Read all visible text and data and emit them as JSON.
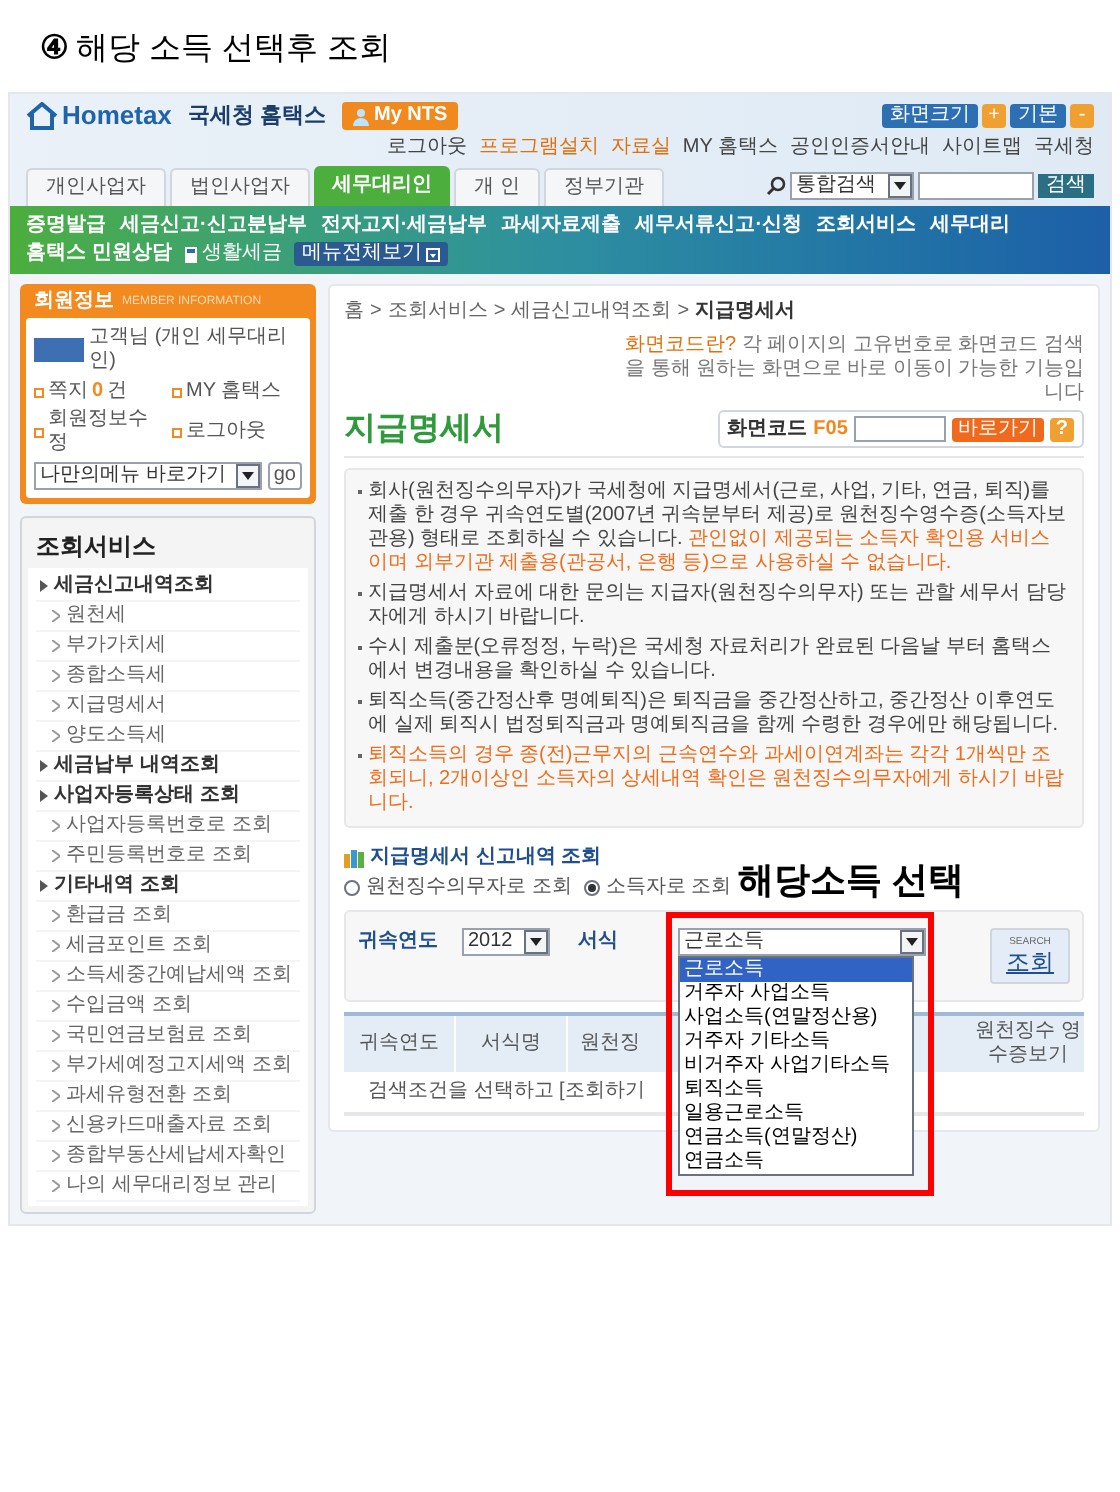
{
  "heading": {
    "number": "④",
    "text": "해당 소득 선택후 조회"
  },
  "header": {
    "logo": "Hometax",
    "site_name": "국세청 홈택스",
    "my_nts": "My NTS",
    "font_size": {
      "label": "화면크기",
      "plus": "+",
      "reset": "기본",
      "minus": "-"
    },
    "top_links": [
      {
        "label": "로그아웃",
        "highlight": false
      },
      {
        "label": "프로그램설치",
        "highlight": true
      },
      {
        "label": "자료실",
        "highlight": true
      },
      {
        "label": "MY 홈택스",
        "highlight": false
      },
      {
        "label": "공인인증서안내",
        "highlight": false
      },
      {
        "label": "사이트맵",
        "highlight": false
      },
      {
        "label": "국세청",
        "highlight": false
      }
    ],
    "tabs": [
      {
        "label": "개인사업자",
        "selected": false
      },
      {
        "label": "법인사업자",
        "selected": false
      },
      {
        "label": "세무대리인",
        "selected": true
      },
      {
        "label": "개 인",
        "selected": false
      },
      {
        "label": "정부기관",
        "selected": false
      }
    ],
    "search": {
      "scope": "통합검색",
      "button": "검색"
    },
    "nav": [
      "증명발급",
      "세금신고·신고분납부",
      "전자고지·세금납부",
      "과세자료제출",
      "세무서류신고·신청",
      "조회서비스",
      "세무대리"
    ],
    "nav_extra": {
      "consult": "홈택스 민원상담",
      "life_tax": "생활세금",
      "all_menu": "메뉴전체보기"
    }
  },
  "member": {
    "title": "회원정보",
    "subtitle": "MEMBER INFORMATION",
    "name": "고객님 (개인 세무대리인)",
    "message": {
      "label": "쪽지",
      "count": "0",
      "unit": "건"
    },
    "links": [
      "MY 홈택스",
      "회원정보수정",
      "로그아웃"
    ],
    "quick_menu": "나만의메뉴 바로가기",
    "go": "go"
  },
  "side_menu": {
    "title": "조회서비스",
    "items": [
      {
        "label": "세금신고내역조회",
        "children": [
          {
            "label": "원천세"
          },
          {
            "label": "부가가치세"
          },
          {
            "label": "종합소득세"
          },
          {
            "label": "지급명세서"
          },
          {
            "label": "양도소득세"
          }
        ]
      },
      {
        "label": "세금납부 내역조회"
      },
      {
        "label": "사업자등록상태 조회",
        "children": [
          {
            "label": "사업자등록번호로 조회"
          },
          {
            "label": "주민등록번호로 조회"
          }
        ]
      },
      {
        "label": "기타내역 조회",
        "children": [
          {
            "label": "환급금 조회"
          },
          {
            "label": "세금포인트 조회"
          },
          {
            "label": "소득세중간예납세액 조회"
          },
          {
            "label": "수입금액 조회"
          },
          {
            "label": "국민연금보험료 조회"
          },
          {
            "label": "부가세예정고지세액 조회"
          },
          {
            "label": "과세유형전환 조회"
          },
          {
            "label": "신용카드매출자료 조회"
          },
          {
            "label": "종합부동산세납세자확인"
          },
          {
            "label": "나의 세무대리정보 관리"
          }
        ]
      }
    ]
  },
  "main": {
    "breadcrumb": [
      "홈",
      "조회서비스",
      "세금신고내역조회",
      "지급명세서"
    ],
    "breadcrumb_separator": ">",
    "title": "지급명세서",
    "code_help": {
      "link": "화면코드란?",
      "text": "각 페이지의 고유번호로 화면코드 검색을 통해 원하는 화면으로 바로 이동이 가능한 기능입니다"
    },
    "code_search": {
      "label": "화면코드",
      "code": "F05",
      "button": "바로가기",
      "help": "?"
    },
    "notices": [
      {
        "segments": [
          {
            "text": "회사(원천징수의무자)가 국세청에 지급명세서(근로, 사업, 기타, 연금, 퇴직)를 제출 한 경우 귀속연도별(2007년 귀속분부터 제공)로 원천징수영수증(소득자보관용) 형태로 조회하실 수 있습니다. ",
            "highlight": false
          },
          {
            "text": "관인없이 제공되는 소득자 확인용 서비스이며 외부기관 제출용(관공서, 은행 등)으로 사용하실 수 없습니다.",
            "highlight": true
          }
        ]
      },
      {
        "segments": [
          {
            "text": "지급명세서 자료에 대한 문의는 지급자(원천징수의무자) 또는 관할 세무서 담당자에게 하시기 바랍니다.",
            "highlight": false
          }
        ]
      },
      {
        "segments": [
          {
            "text": "수시 제출분(오류정정, 누락)은 국세청 자료처리가 완료된 다음날 부터 홈택스에서 변경내용을 확인하실 수 있습니다.",
            "highlight": false
          }
        ]
      },
      {
        "segments": [
          {
            "text": "퇴직소득(중간정산후 명예퇴직)은 퇴직금을 중간정산하고, 중간정산 이후연도에 실제 퇴직시 법정퇴직금과 명예퇴직금을 함께 수령한 경우에만 해당됩니다.",
            "highlight": false
          }
        ]
      },
      {
        "segments": [
          {
            "text": "퇴직소득의 경우 종(전)근무지의 근속연수와 과세이연계좌는 각각 1개씩만 조회되니, 2개이상인 소득자의 상세내역 확인은 원천징수의무자에게 하시기 바랍니다.",
            "highlight": true
          }
        ]
      }
    ],
    "query": {
      "title": "지급명세서 신고내역 조회",
      "annotation": "해당소득 선택",
      "radios": [
        {
          "label": "원천징수의무자로 조회",
          "selected": false
        },
        {
          "label": "소득자로 조회",
          "selected": true
        }
      ],
      "year_label": "귀속연도",
      "year": "2012",
      "form_label": "서식",
      "form_value": "근로소득",
      "options": [
        {
          "label": "근로소득",
          "selected": true
        },
        {
          "label": "거주자 사업소득",
          "selected": false
        },
        {
          "label": "사업소득(연말정산용)",
          "selected": false
        },
        {
          "label": "거주자 기타소득",
          "selected": false
        },
        {
          "label": "비거주자 사업기타소득",
          "selected": false
        },
        {
          "label": "퇴직소득",
          "selected": false
        },
        {
          "label": "일용근로소득",
          "selected": false
        },
        {
          "label": "연금소득(연말정산)",
          "selected": false
        },
        {
          "label": "연금소득",
          "selected": false
        }
      ],
      "search_caption": "SEARCH",
      "search_label": "조회"
    },
    "table": {
      "columns": [
        "귀속연도",
        "서식명",
        "원천징",
        "원천징수 영수증보기"
      ],
      "empty_message": "검색조건을 선택하고 [조회하기"
    }
  }
}
